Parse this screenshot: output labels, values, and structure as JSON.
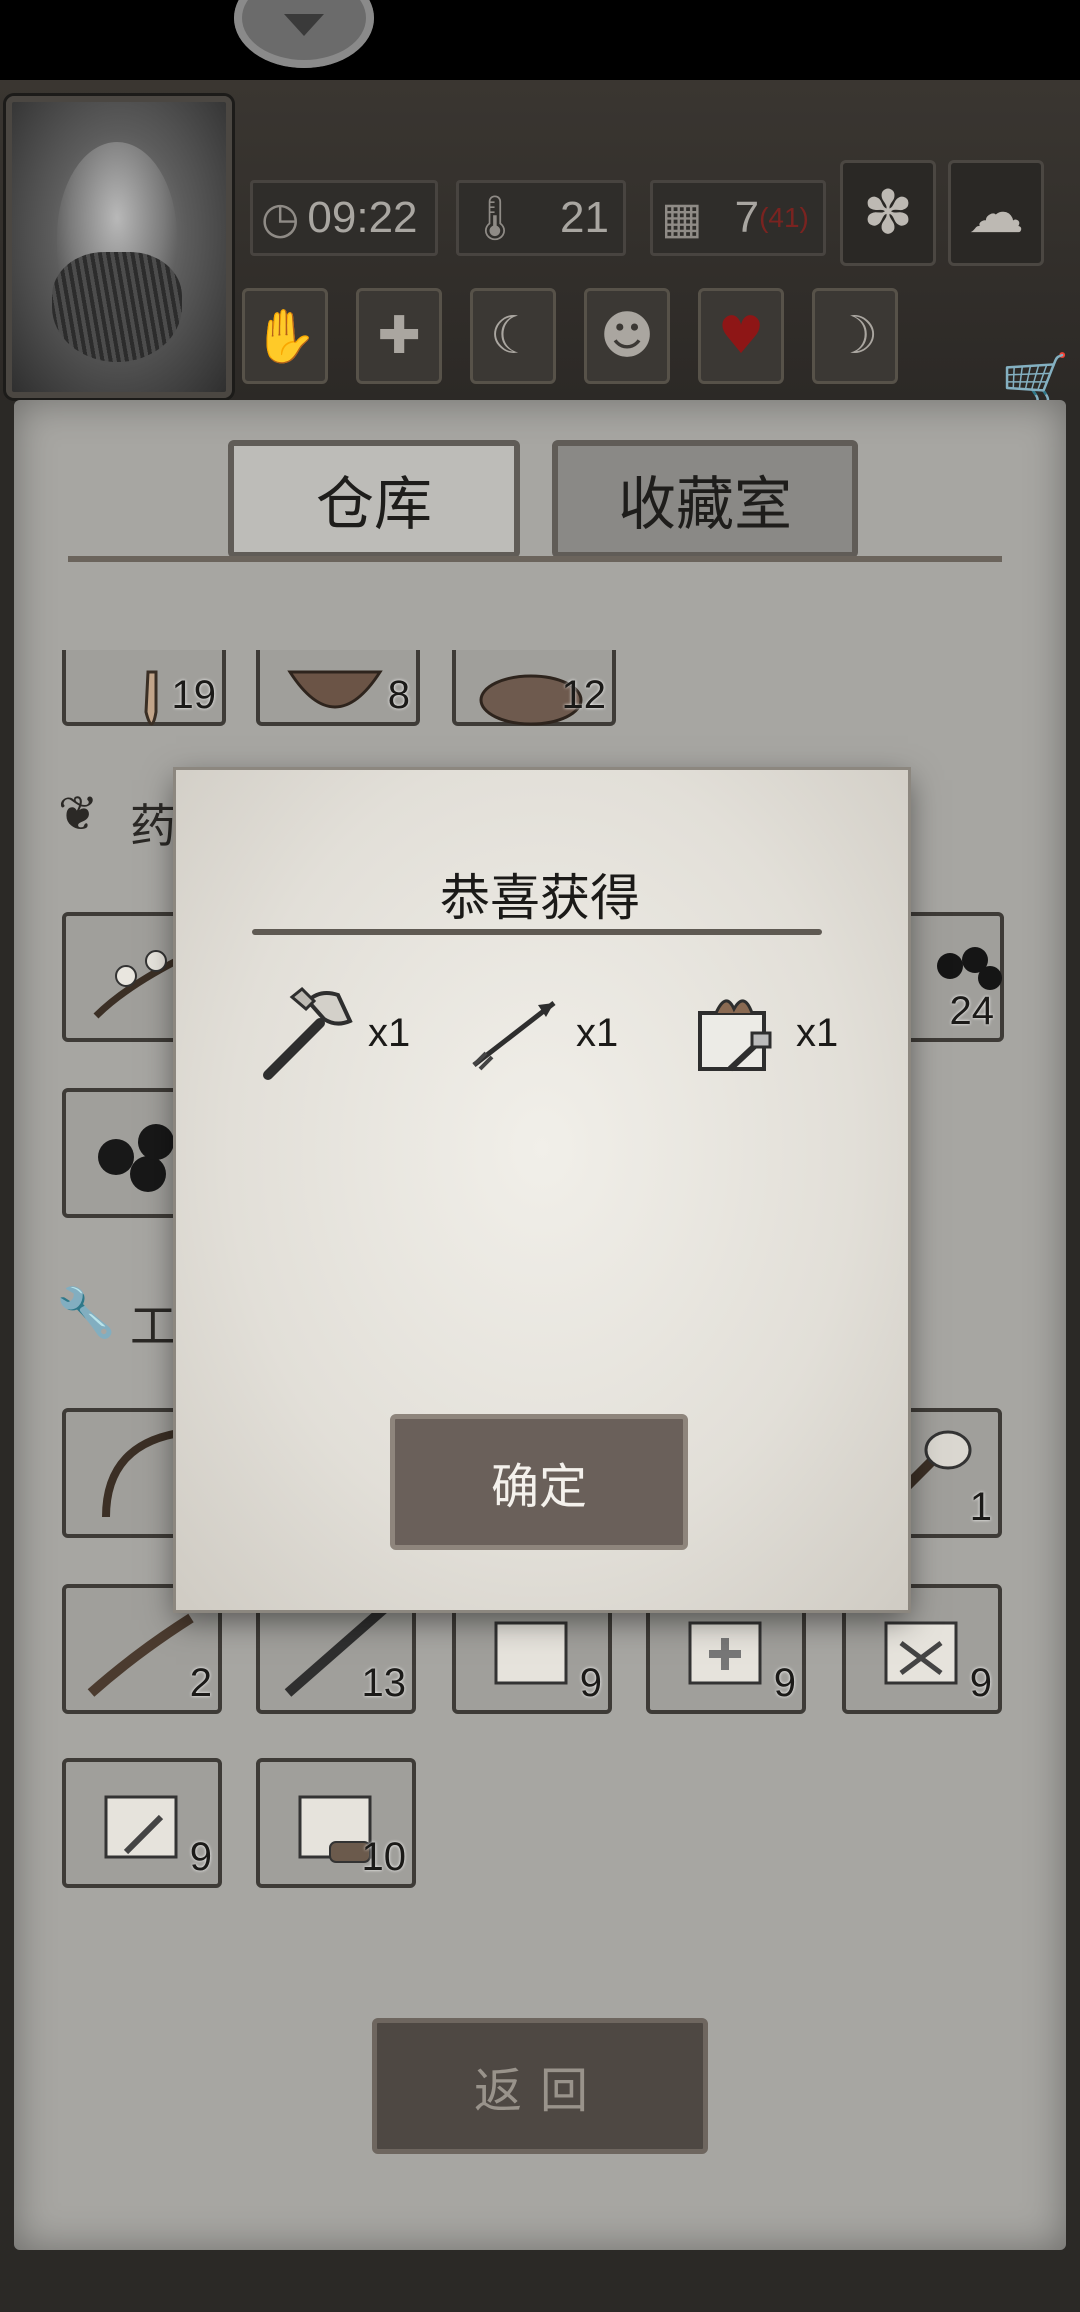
{
  "hud": {
    "time": "09:22",
    "temperature": "21",
    "day": "7",
    "day_max": "(41)",
    "icons": [
      "clock-icon",
      "thermometer-icon",
      "calendar-icon",
      "leaf-icon",
      "rain-cloud-icon",
      "cart-icon"
    ],
    "tool_icons": [
      "hand-icon",
      "medical-cross-icon",
      "stomach-icon",
      "head-icon",
      "heart-icon",
      "moon-icon"
    ]
  },
  "tabs": [
    {
      "label": "仓库",
      "active": true
    },
    {
      "label": "收藏室",
      "active": false
    }
  ],
  "inventory": {
    "top_row": [
      {
        "icon": "seed-icon",
        "count": "19"
      },
      {
        "icon": "coconut-icon",
        "count": "8"
      },
      {
        "icon": "meat-icon",
        "count": "12"
      }
    ],
    "sections": [
      {
        "icon": "herb-leaf-icon",
        "label": "药"
      },
      {
        "icon": "wrench-icon",
        "label": "工"
      }
    ],
    "herb_row": [
      {
        "icon": "flower-branch-icon",
        "count": ""
      },
      {
        "icon": "berries-icon",
        "count": "24"
      }
    ],
    "herb_row2": [
      {
        "icon": "blackberries-icon",
        "count": ""
      }
    ],
    "tool_row": [
      {
        "icon": "bow-icon",
        "count": ""
      },
      {
        "icon": "stone-hammer-icon",
        "count": "1"
      }
    ],
    "tool_row2": [
      {
        "icon": "feather-knife-icon",
        "count": "2"
      },
      {
        "icon": "stick-icon",
        "count": "13"
      },
      {
        "icon": "food-giftbox-icon",
        "count": "9"
      },
      {
        "icon": "medical-giftbox-icon",
        "count": "9"
      },
      {
        "icon": "weapon-giftbox-icon",
        "count": "9"
      }
    ],
    "tool_row3": [
      {
        "icon": "tool-giftbox-icon",
        "count": "9"
      },
      {
        "icon": "wood-giftbox-icon",
        "count": "10"
      }
    ]
  },
  "dialog": {
    "title": "恭喜获得",
    "rewards": [
      {
        "icon": "axe-icon",
        "qty": "x1"
      },
      {
        "icon": "arrow-icon",
        "qty": "x1"
      },
      {
        "icon": "tool-giftbox-icon",
        "qty": "x1"
      }
    ],
    "confirm_label": "确定"
  },
  "back_label": "返回"
}
